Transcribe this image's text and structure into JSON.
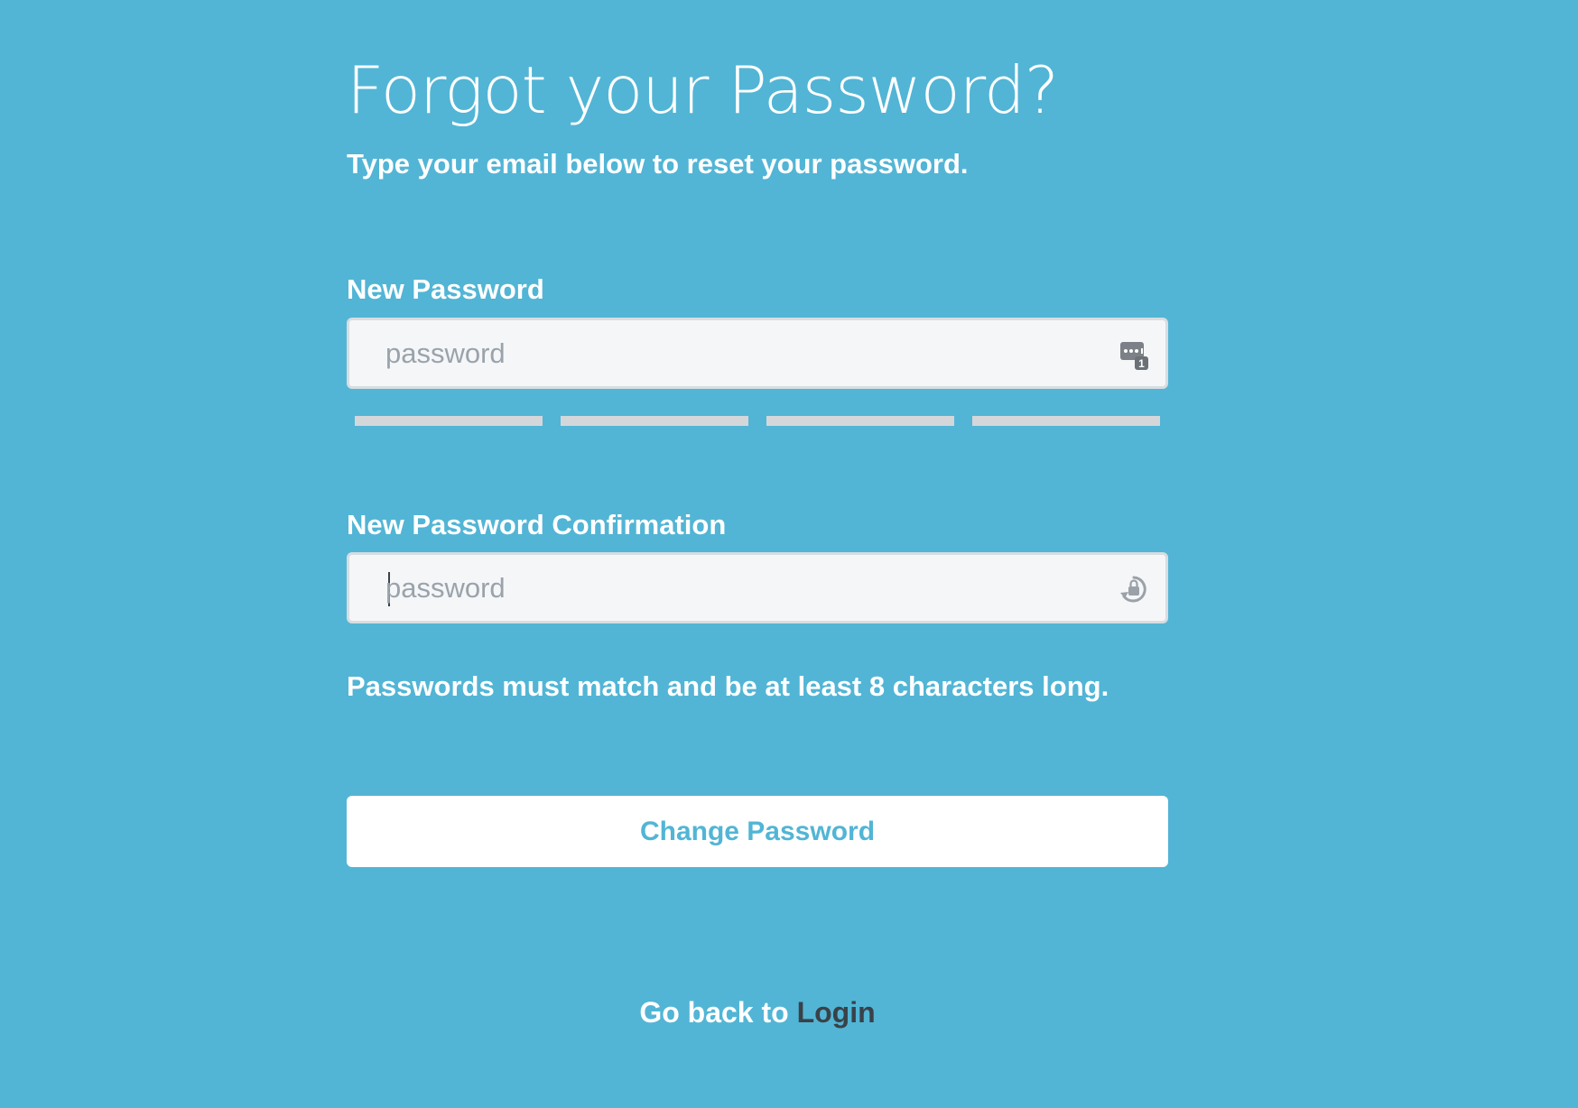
{
  "page": {
    "title": "Forgot your Password?",
    "subtitle": "Type your email below to reset your password."
  },
  "form": {
    "new_password": {
      "label": "New Password",
      "placeholder": "password",
      "value": "",
      "icon": "password-manager-icon"
    },
    "password_strength": {
      "segments": 4,
      "filled": 0
    },
    "confirm_password": {
      "label": "New Password Confirmation",
      "placeholder": "password",
      "value": "",
      "icon": "password-generator-icon"
    },
    "hint": "Passwords must match and be at least 8 characters long.",
    "submit_label": "Change Password"
  },
  "footer": {
    "back_text": "Go back to ",
    "login_link": "Login"
  },
  "colors": {
    "background": "#52b5d5",
    "field_background": "#f5f6f8",
    "field_border": "#d8dde1",
    "button_background": "#ffffff",
    "button_text": "#52b5d5",
    "link": "#3a4148",
    "strength_empty": "#d4d7da"
  }
}
